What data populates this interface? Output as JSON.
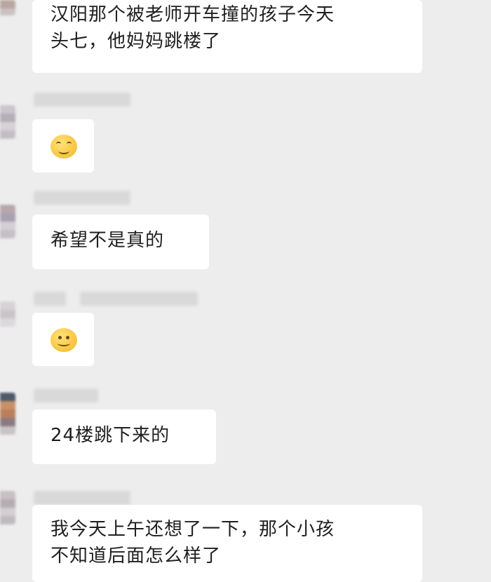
{
  "messages": [
    {
      "type": "text",
      "lines": [
        "汉阳那个被老师开车撞的孩子今天",
        "头七，他妈妈跳楼了"
      ]
    },
    {
      "type": "emoji",
      "emoji": "grinning-face-emoji"
    },
    {
      "type": "text",
      "lines": [
        "希望不是真的"
      ]
    },
    {
      "type": "emoji",
      "emoji": "smiling-face-emoji"
    },
    {
      "type": "text",
      "lines": [
        "24楼跳下来的"
      ]
    },
    {
      "type": "text",
      "lines": [
        "我今天上午还想了一下，那个小孩",
        "不知道后面怎么样了"
      ]
    }
  ],
  "colors": {
    "background": "#ededed",
    "bubble": "#ffffff",
    "text": "#1f1f1f"
  }
}
